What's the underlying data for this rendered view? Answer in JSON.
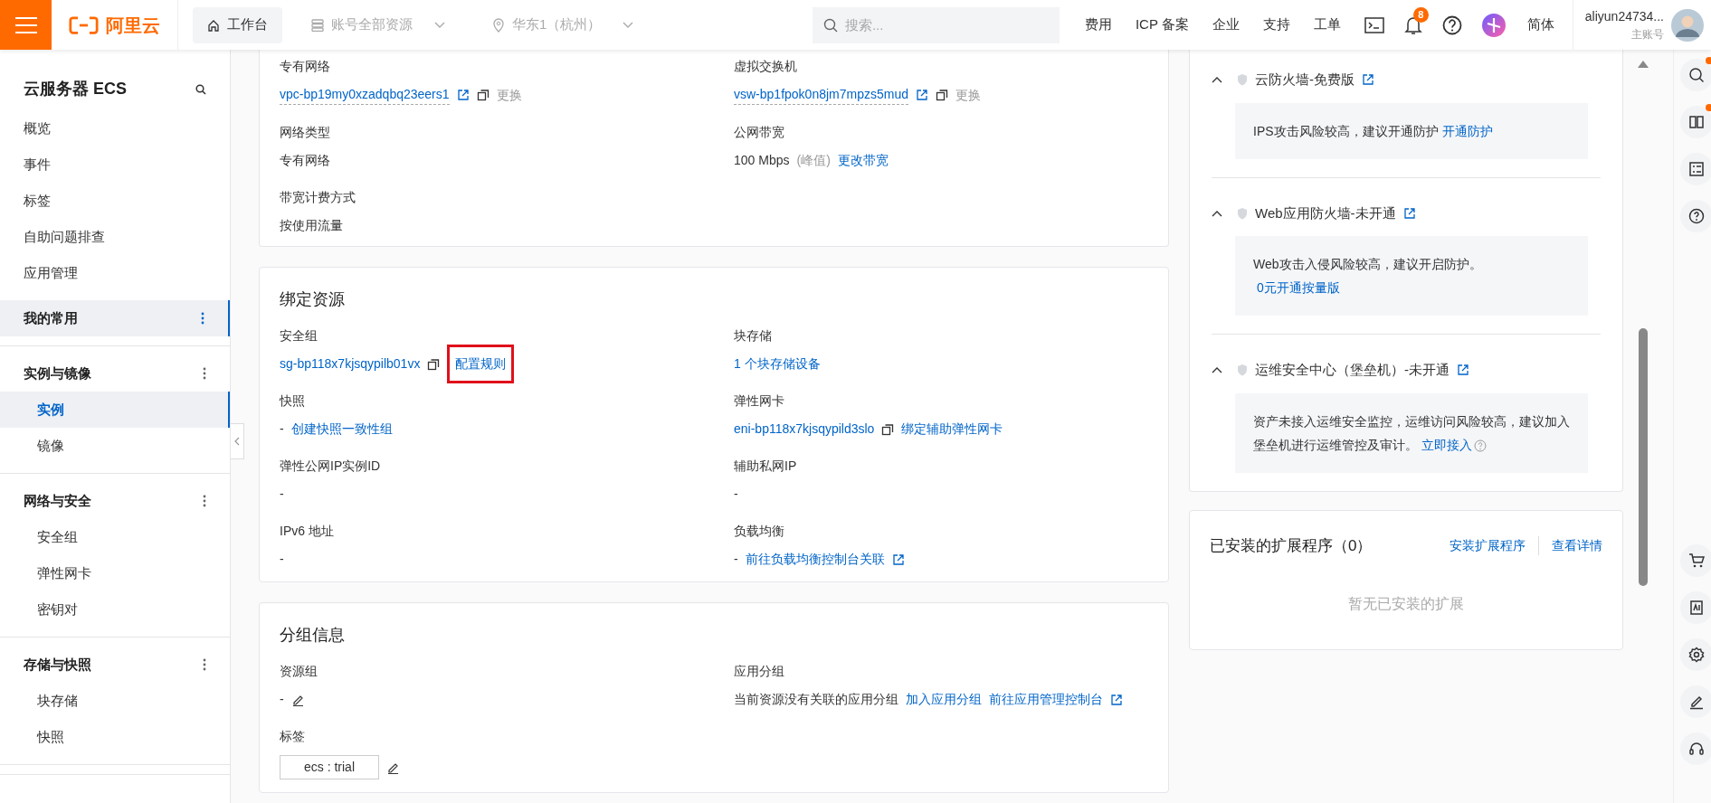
{
  "top_bar": {
    "logo_text": "阿里云",
    "workbench": "工作台",
    "resource_scope": "账号全部资源",
    "region": "华东1（杭州）",
    "search_placeholder": "搜索...",
    "nav_links": [
      "费用",
      "ICP 备案",
      "企业",
      "支持",
      "工单"
    ],
    "notification_count": "8",
    "language": "简体",
    "account_name": "aliyun24734...",
    "account_type": "主账号"
  },
  "sidebar": {
    "title": "云服务器 ECS",
    "items": [
      {
        "kind": "item",
        "label": "概览"
      },
      {
        "kind": "item",
        "label": "事件"
      },
      {
        "kind": "item",
        "label": "标签"
      },
      {
        "kind": "item",
        "label": "自助问题排查"
      },
      {
        "kind": "item",
        "label": "应用管理"
      },
      {
        "kind": "group",
        "label": "我的常用",
        "selected": true
      },
      {
        "kind": "group",
        "label": "实例与镜像",
        "selected": false,
        "children": [
          {
            "label": "实例",
            "selected": true
          },
          {
            "label": "镜像",
            "selected": false
          }
        ]
      },
      {
        "kind": "group",
        "label": "网络与安全",
        "selected": false,
        "children": [
          {
            "label": "安全组",
            "selected": false
          },
          {
            "label": "弹性网卡",
            "selected": false
          },
          {
            "label": "密钥对",
            "selected": false
          }
        ]
      },
      {
        "kind": "group",
        "label": "存储与快照",
        "selected": false,
        "children": [
          {
            "label": "块存储",
            "selected": false
          },
          {
            "label": "快照",
            "selected": false
          }
        ]
      }
    ]
  },
  "cards": [
    {
      "fields": [
        {
          "label": "专有网络",
          "value": [
            {
              "kind": "id-link",
              "text": "vpc-bp19my0xzadqbq23eers1"
            },
            {
              "kind": "external"
            },
            {
              "kind": "copy"
            },
            {
              "kind": "muted",
              "text": "更换"
            }
          ]
        },
        {
          "label": "虚拟交换机",
          "value": [
            {
              "kind": "id-link",
              "text": "vsw-bp1fpok0n8jm7mpzs5mud"
            },
            {
              "kind": "external"
            },
            {
              "kind": "copy"
            },
            {
              "kind": "muted",
              "text": "更换"
            }
          ]
        },
        {
          "label": "网络类型",
          "value": [
            {
              "kind": "text",
              "text": "专有网络"
            }
          ]
        },
        {
          "label": "公网带宽",
          "value": [
            {
              "kind": "text",
              "text": "100 Mbps"
            },
            {
              "kind": "muted",
              "text": "(峰值)"
            },
            {
              "kind": "link",
              "text": "更改带宽"
            }
          ]
        },
        {
          "label": "带宽计费方式",
          "value": [
            {
              "kind": "text",
              "text": "按使用流量"
            }
          ]
        }
      ]
    },
    {
      "title": "绑定资源",
      "fields": [
        {
          "label": "安全组",
          "value": [
            {
              "kind": "link",
              "text": "sg-bp118x7kjsqypilb01vx"
            },
            {
              "kind": "copy"
            },
            {
              "kind": "boxed-link",
              "text": "配置规则"
            }
          ]
        },
        {
          "label": "块存储",
          "value": [
            {
              "kind": "link",
              "text": "1 个块存储设备"
            }
          ]
        },
        {
          "label": "快照",
          "value": [
            {
              "kind": "text",
              "text": "-"
            },
            {
              "kind": "link",
              "text": "创建快照一致性组"
            }
          ]
        },
        {
          "label": "弹性网卡",
          "value": [
            {
              "kind": "link",
              "text": "eni-bp118x7kjsqypild3slo"
            },
            {
              "kind": "copy"
            },
            {
              "kind": "link",
              "text": "绑定辅助弹性网卡"
            }
          ]
        },
        {
          "label": "弹性公网IP实例ID",
          "value": [
            {
              "kind": "text",
              "text": "-"
            }
          ]
        },
        {
          "label": "辅助私网IP",
          "value": [
            {
              "kind": "text",
              "text": "-"
            }
          ]
        },
        {
          "label": "IPv6 地址",
          "value": [
            {
              "kind": "text",
              "text": "-"
            }
          ]
        },
        {
          "label": "负载均衡",
          "value": [
            {
              "kind": "text",
              "text": "-"
            },
            {
              "kind": "link",
              "text": "前往负载均衡控制台关联"
            },
            {
              "kind": "external"
            }
          ]
        }
      ]
    },
    {
      "title": "分组信息",
      "fields": [
        {
          "label": "资源组",
          "value": [
            {
              "kind": "text",
              "text": "-"
            },
            {
              "kind": "edit"
            }
          ]
        },
        {
          "label": "应用分组",
          "value": [
            {
              "kind": "text",
              "text": "当前资源没有关联的应用分组"
            },
            {
              "kind": "link",
              "text": "加入应用分组"
            },
            {
              "kind": "link",
              "text": "前往应用管理控制台"
            },
            {
              "kind": "external"
            }
          ]
        },
        {
          "label": "标签",
          "value": [
            {
              "kind": "tag",
              "text": "ecs : trial"
            },
            {
              "kind": "edit"
            }
          ]
        }
      ]
    }
  ],
  "security": [
    {
      "title": "云防火墙-免费版",
      "expanded": true,
      "message": [
        {
          "kind": "text",
          "text": "IPS攻击风险较高，建议开通防护"
        },
        {
          "kind": "link",
          "text": "开通防护"
        }
      ]
    },
    {
      "title": "Web应用防火墙-未开通",
      "expanded": true,
      "message": [
        {
          "kind": "text",
          "text": "Web攻击入侵风险较高，建议开启防护。"
        },
        {
          "kind": "break"
        },
        {
          "kind": "link",
          "text": "0元开通按量版"
        }
      ]
    },
    {
      "title": "运维安全中心（堡垒机）-未开通",
      "expanded": true,
      "message": [
        {
          "kind": "text",
          "text": "资产未接入运维安全监控，运维访问风险较高，建议加入堡垒机进行运维管控及审计。"
        },
        {
          "kind": "link",
          "text": "立即接入"
        },
        {
          "kind": "help"
        }
      ]
    }
  ],
  "extensions": {
    "title": "已安装的扩展程序（0）",
    "actions": [
      "安装扩展程序",
      "查看详情"
    ],
    "empty_text": "暂无已安装的扩展"
  }
}
